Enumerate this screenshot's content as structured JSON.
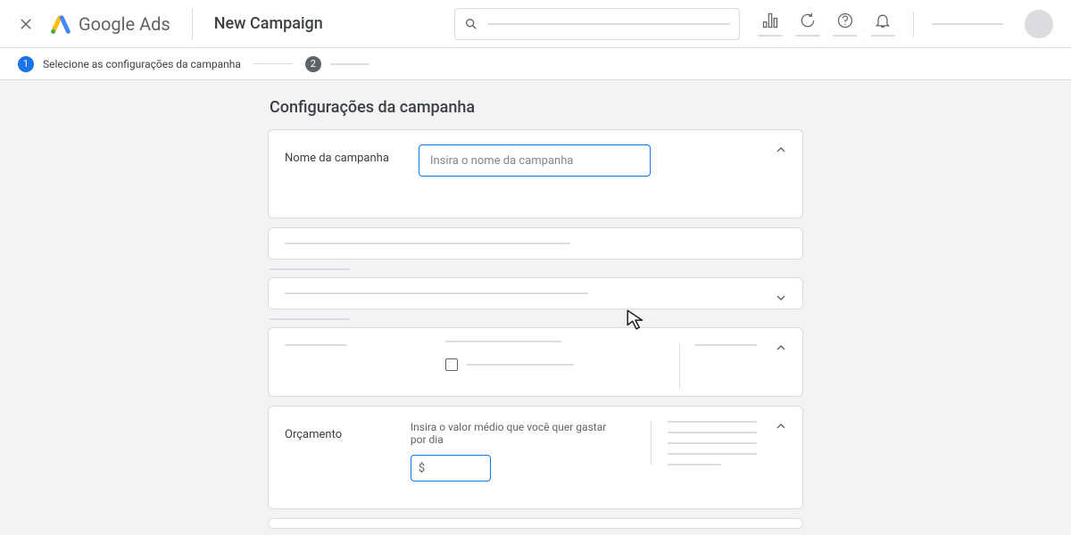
{
  "header": {
    "logo_text": "Google Ads",
    "page_title": "New Campaign"
  },
  "stepper": {
    "step1": {
      "num": "1",
      "label": "Selecione as configurações da campanha"
    },
    "step2": {
      "num": "2"
    }
  },
  "section_title": "Configurações da campanha",
  "campaign_name": {
    "label": "Nome da campanha",
    "placeholder": "Insira o nome da campanha",
    "value": ""
  },
  "budget": {
    "label": "Orçamento",
    "description": "Insira o valor médio que você quer gastar por dia",
    "currency": "$",
    "value": ""
  }
}
